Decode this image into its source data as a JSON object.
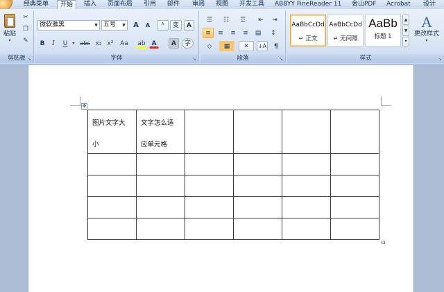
{
  "tabs": [
    {
      "label": "经典菜单",
      "active": false
    },
    {
      "label": "开始",
      "active": true
    },
    {
      "label": "插入",
      "active": false
    },
    {
      "label": "页面布局",
      "active": false
    },
    {
      "label": "引用",
      "active": false
    },
    {
      "label": "邮件",
      "active": false
    },
    {
      "label": "审阅",
      "active": false
    },
    {
      "label": "视图",
      "active": false
    },
    {
      "label": "开发工具",
      "active": false
    },
    {
      "label": "ABBYY FineReader 11",
      "active": false
    },
    {
      "label": "金山PDF",
      "active": false
    },
    {
      "label": "Acrobat",
      "active": false
    },
    {
      "label": "设计",
      "active": false
    }
  ],
  "ribbon": {
    "clipboard": {
      "label": "剪贴板",
      "paste_label": "粘贴",
      "cut_icon": "✂",
      "copy_icon": "❐",
      "painter_icon": "✎"
    },
    "font": {
      "label": "字体",
      "font_name": "微软雅黑",
      "font_size": "五号",
      "grow": "A",
      "shrink": "A",
      "clear": "ᴬ",
      "phonetic": "变",
      "border_char": "A",
      "bold": "B",
      "italic": "I",
      "underline": "U",
      "strike": "abc",
      "subscript": "x₂",
      "superscript": "x²",
      "change_case": "Aa",
      "highlight": "ab",
      "font_color": "A",
      "char_shading": "A",
      "enclose": "字"
    },
    "paragraph": {
      "label": "段落",
      "bullets": "☰",
      "numbering": "☷",
      "multilevel": "☲",
      "decrease_indent": "⇤",
      "increase_indent": "⇥",
      "align_left": "≡",
      "center": "≡",
      "align_right": "≡",
      "justify": "≡",
      "distributed": "▤",
      "line_spacing": "↕",
      "shading": "◇",
      "borders": "▦",
      "chinese_layout": "✕",
      "sort": "↓A",
      "show_marks": "¶"
    },
    "styles": {
      "label": "样式",
      "cards": [
        {
          "sample": "AaBbCcDd",
          "name": "↵ 正文",
          "selected": true,
          "big": false
        },
        {
          "sample": "AaBbCcDd",
          "name": "↵ 无间隔",
          "selected": false,
          "big": false
        },
        {
          "sample": "AaBb",
          "name": "标题 1",
          "selected": false,
          "big": true
        }
      ],
      "change_styles_label": "更改样式",
      "change_styles_icon": "A"
    },
    "launcher_icon": "↘"
  },
  "document": {
    "move_handle_icon": "✥",
    "table": {
      "rows": [
        [
          {
            "lines": [
              "图片文字大",
              "小"
            ]
          },
          {
            "lines": [
              "文字怎么适",
              "应单元格"
            ]
          },
          {
            "lines": []
          },
          {
            "lines": []
          },
          {
            "lines": []
          },
          {
            "lines": []
          }
        ],
        [
          {
            "lines": []
          },
          {
            "lines": []
          },
          {
            "lines": []
          },
          {
            "lines": []
          },
          {
            "lines": []
          },
          {
            "lines": []
          }
        ],
        [
          {
            "lines": []
          },
          {
            "lines": []
          },
          {
            "lines": []
          },
          {
            "lines": []
          },
          {
            "lines": []
          },
          {
            "lines": []
          }
        ],
        [
          {
            "lines": []
          },
          {
            "lines": []
          },
          {
            "lines": []
          },
          {
            "lines": []
          },
          {
            "lines": []
          },
          {
            "lines": []
          }
        ],
        [
          {
            "lines": []
          },
          {
            "lines": []
          },
          {
            "lines": []
          },
          {
            "lines": []
          },
          {
            "lines": []
          },
          {
            "lines": []
          }
        ]
      ]
    }
  },
  "colors": {
    "highlight": "#ffff00",
    "font_color": "#e0241b",
    "accent": "#e7a94a"
  }
}
